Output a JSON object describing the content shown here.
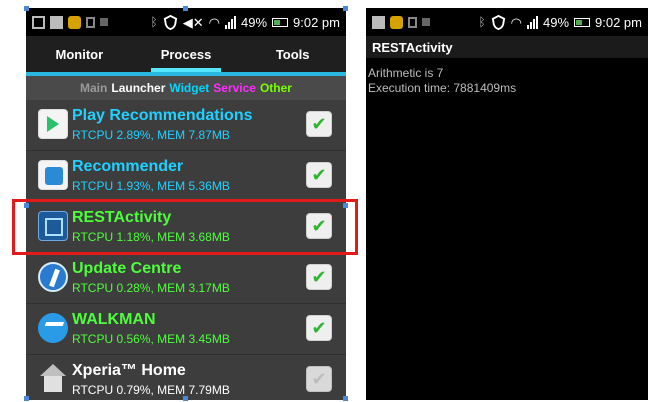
{
  "left": {
    "status": {
      "battery": "49%",
      "time": "9:02 pm"
    },
    "tabs": [
      "Monitor",
      "Process",
      "Tools"
    ],
    "active_tab": "Process",
    "filters": {
      "main": "Main",
      "launcher": "Launcher",
      "widget": "Widget",
      "service": "Service",
      "other": "Other"
    },
    "apps": [
      {
        "name": "Play Recommendations",
        "stats": "RTCPU 2.89%, MEM 7.87MB",
        "icon": "play-store-icon",
        "checked": true
      },
      {
        "name": "Recommender",
        "stats": "RTCPU 1.93%, MEM 5.36MB",
        "icon": "recommender-icon",
        "checked": true
      },
      {
        "name": "RESTActivity",
        "stats": "RTCPU 1.18%, MEM 3.68MB",
        "icon": "restactivity-icon",
        "checked": true,
        "highlighted": true
      },
      {
        "name": "Update Centre",
        "stats": "RTCPU 0.28%, MEM 3.17MB",
        "icon": "update-centre-icon",
        "checked": true
      },
      {
        "name": "WALKMAN",
        "stats": "RTCPU 0.56%, MEM 3.45MB",
        "icon": "walkman-icon",
        "checked": true
      },
      {
        "name": "Xperia™ Home",
        "stats": "RTCPU 0.79%, MEM 7.79MB",
        "icon": "home-icon",
        "checked": true,
        "disabled": true
      }
    ],
    "colors": {
      "tab_accent": "#2ab7e0",
      "highlight_box": "#e11b1b",
      "name_cyan": "#20d1ff",
      "name_green": "#4dff3a"
    }
  },
  "right": {
    "status": {
      "battery": "49%",
      "time": "9:02 pm"
    },
    "title": "RESTActivity",
    "lines": [
      "Arithmetic is 7",
      "Execution time: 7881409ms"
    ]
  }
}
